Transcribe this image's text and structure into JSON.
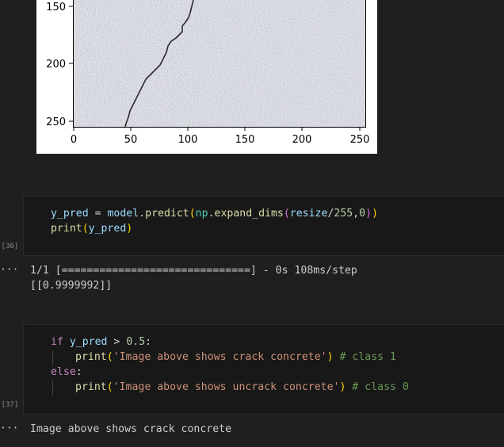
{
  "image_output": {
    "y_ticks": [
      "150",
      "200",
      "250"
    ],
    "x_ticks": [
      "0",
      "50",
      "100",
      "150",
      "200",
      "250"
    ]
  },
  "cell36": {
    "exec_count": "[36]",
    "line1": {
      "var": "y_pred",
      "eq": " = ",
      "obj": "model",
      "dot": ".",
      "fn": "predict",
      "p_open": "(",
      "mod": "np",
      "dot2": ".",
      "fn2": "expand_dims",
      "p2_open": "(",
      "arg": "resize",
      "slash": "/",
      "num1": "255",
      "comma": ",",
      "num2": "0",
      "p2_close": ")",
      "p_close": ")"
    },
    "line2": {
      "fn": "print",
      "p_open": "(",
      "arg": "y_pred",
      "p_close": ")"
    }
  },
  "output36": {
    "ellipsis": "···",
    "line1": "1/1 [==============================] - 0s 108ms/step",
    "line2": "[[0.9999992]]"
  },
  "cell37": {
    "exec_count": "[37]",
    "line1": {
      "kw": "if",
      "sp": " ",
      "var": "y_pred",
      "op": " > ",
      "num": "0.5",
      "colon": ":"
    },
    "line2": {
      "fn": "print",
      "p_open": "(",
      "str": "'Image above shows crack concrete'",
      "p_close": ")",
      "cmt": " # class 1"
    },
    "line3": {
      "kw": "else",
      "colon": ":"
    },
    "line4": {
      "fn": "print",
      "p_open": "(",
      "str": "'Image above shows uncrack concrete'",
      "p_close": ")",
      "cmt": " # class 0"
    }
  },
  "output37": {
    "ellipsis": "···",
    "line1": "Image above shows crack concrete"
  }
}
